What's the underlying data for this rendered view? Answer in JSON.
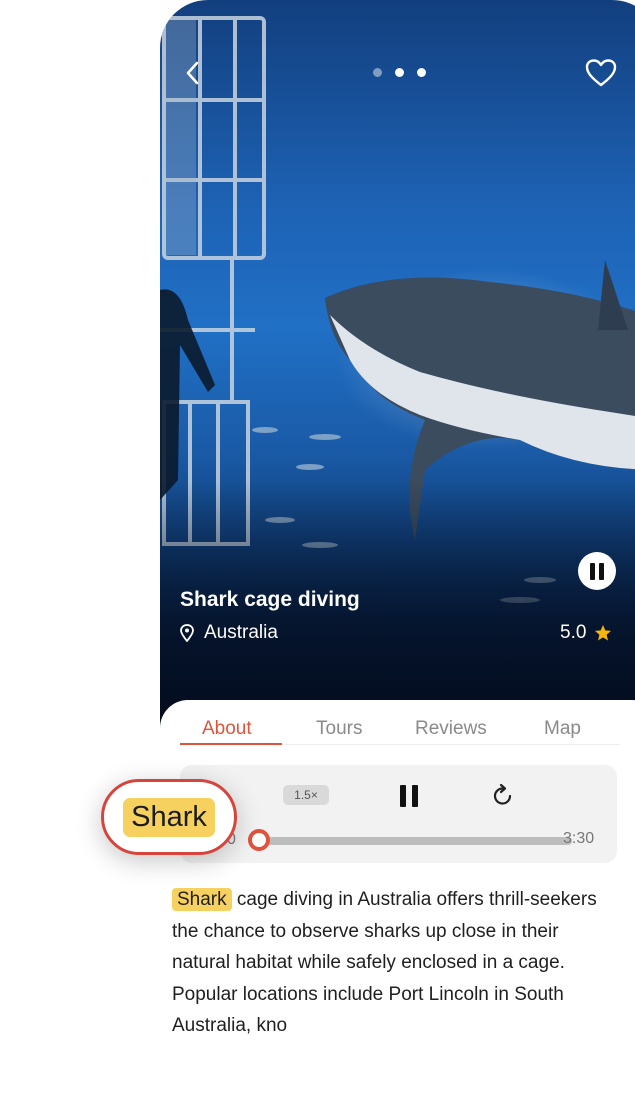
{
  "hero": {
    "title": "Shark cage diving",
    "location": "Australia",
    "rating": "5.0",
    "carousel_total": 3,
    "carousel_active": 0
  },
  "tabs": [
    "About",
    "Tours",
    "Reviews",
    "Map"
  ],
  "active_tab": "About",
  "player": {
    "speed_label": "1.5×",
    "elapsed": "0",
    "total": "3:30",
    "progress": 0.0
  },
  "description": {
    "highlight_word": "Shark",
    "text": "cage diving in Australia offers thrill-seekers the chance to observe sharks up close in their natural habitat while safely enclosed in a cage. Popular locations include Port Lincoln in South Australia, kno"
  },
  "callout": {
    "word": "Shark"
  },
  "colors": {
    "accent": "#e0533c",
    "highlight": "#f7d15f",
    "star": "#f5b50a"
  },
  "icons": [
    "back-chevron-icon",
    "heart-icon",
    "pause-icon",
    "location-pin-icon",
    "star-icon",
    "refresh-icon"
  ]
}
